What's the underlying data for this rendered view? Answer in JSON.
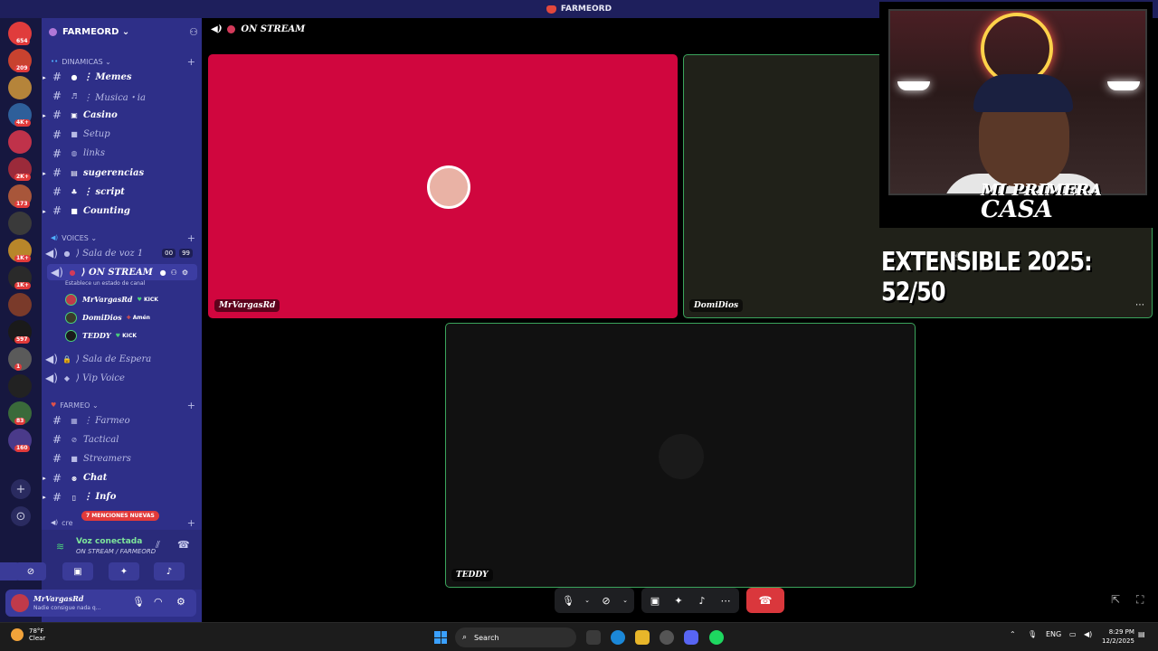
{
  "window": {
    "title": "FARMEORD"
  },
  "server_rail": {
    "items": [
      {
        "name": "Discord home",
        "badge": "654",
        "color": "#e03c3c"
      },
      {
        "name": "server-2",
        "badge": "209",
        "color": "#c8422f"
      },
      {
        "name": "server-3",
        "badge": "",
        "color": "#b5843a"
      },
      {
        "name": "server-4",
        "badge": "4K+",
        "color": "#2e5f9a"
      },
      {
        "name": "server-5",
        "badge": "",
        "color": "#c0324a"
      },
      {
        "name": "server-6",
        "badge": "2K+",
        "color": "#9b2a3a"
      },
      {
        "name": "server-7",
        "badge": "173",
        "color": "#a8563a"
      },
      {
        "name": "server-8",
        "badge": "",
        "color": "#3a3a3a"
      },
      {
        "name": "server-9",
        "badge": "1K+",
        "color": "#b8862a"
      },
      {
        "name": "server-10",
        "badge": "1K+",
        "color": "#2a2a2a"
      },
      {
        "name": "server-11",
        "badge": "",
        "color": "#7a3a2a"
      },
      {
        "name": "server-12",
        "badge": "597",
        "color": "#1a1a1a"
      },
      {
        "name": "server-13",
        "badge": "1",
        "color": "#5a5a5a"
      },
      {
        "name": "server-14",
        "badge": "",
        "color": "#222"
      },
      {
        "name": "server-15",
        "badge": "83",
        "color": "#3a6a3a"
      },
      {
        "name": "server-16",
        "badge": "160",
        "color": "#4a3a8a"
      }
    ],
    "add_server": "+",
    "discover": "⊙"
  },
  "server": {
    "name": "FARMEORD",
    "categories": [
      {
        "label": "DINAMICAS"
      },
      {
        "label": "VOICES"
      },
      {
        "label": "FARMEO"
      },
      {
        "label": "cre"
      }
    ],
    "channels_dinamicas": [
      {
        "emoji": "●",
        "name": "⋮ Memes",
        "bold": true
      },
      {
        "emoji": "♬",
        "name": "⋮ Musica・ia",
        "bold": false
      },
      {
        "emoji": "▣",
        "name": "Casino",
        "bold": true
      },
      {
        "emoji": "■",
        "name": "Setup",
        "bold": false
      },
      {
        "emoji": "◍",
        "name": "links",
        "bold": false
      },
      {
        "emoji": "▤",
        "name": "sugerencias",
        "bold": true
      },
      {
        "emoji": "♣",
        "name": "⋮ script",
        "bold": true
      },
      {
        "emoji": "■",
        "name": "Counting",
        "bold": true
      }
    ],
    "voice_channels": [
      {
        "name": "⟩ Sala de voz 1",
        "counts": [
          "00",
          "99"
        ]
      },
      {
        "name": "⟩ ON STREAM",
        "active": true
      }
    ],
    "status_hint": "Establece un estado de canal",
    "voice_users": [
      {
        "name": "MrVargasRd",
        "tag": "KICK",
        "tag_icon": "♥",
        "color": "#c03a4a"
      },
      {
        "name": "DomiDios",
        "tag": "Amén",
        "tag_icon": "✚",
        "color": "#3a3a2a"
      },
      {
        "name": "TEDDY",
        "tag": "KICK",
        "tag_icon": "♥",
        "color": "#1a1a1a"
      }
    ],
    "voice_channels_2": [
      {
        "emoji": "🔒",
        "name": "⟩ Sala de Espera"
      },
      {
        "emoji": "◆",
        "name": "⟩ Vip Voice"
      }
    ],
    "channels_farmeo": [
      {
        "emoji": "▦",
        "name": "⋮ Farmeo",
        "bold": false
      },
      {
        "emoji": "⊘",
        "name": "Tactical",
        "bold": false
      },
      {
        "emoji": "■",
        "name": "Streamers",
        "bold": false
      },
      {
        "emoji": "⊗",
        "name": "Chat",
        "bold": true
      },
      {
        "emoji": "▯",
        "name": "⋮ Info",
        "bold": true
      }
    ],
    "mentions_badge": "7 MENCIONES NUEVAS"
  },
  "voice_panel": {
    "title": "Voz conectada",
    "subtitle": "ON STREAM / FARMEORD"
  },
  "user_panel": {
    "name": "MrVargasRd",
    "status": "Nadie consigue nada q..."
  },
  "stage": {
    "title": "ON STREAM",
    "tiles": [
      {
        "name": "MrVargasRd",
        "bg": "#d0063e",
        "border": "#d0063e"
      },
      {
        "name": "DomiDios",
        "bg": "#202119",
        "border": "#3ba55c"
      },
      {
        "name": "TEDDY",
        "bg": "#111111",
        "border": "#3ba55c"
      }
    ]
  },
  "overlay": {
    "caption_line1": "MI PRIMERA",
    "caption_line2": "CASA",
    "extensible": "EXTENSIBLE 2025: 52/50"
  },
  "taskbar": {
    "weather_temp": "78°F",
    "weather_desc": "Clear",
    "search_placeholder": "Search",
    "lang": "ENG",
    "time": "8:29 PM",
    "date": "12/2/2025"
  }
}
